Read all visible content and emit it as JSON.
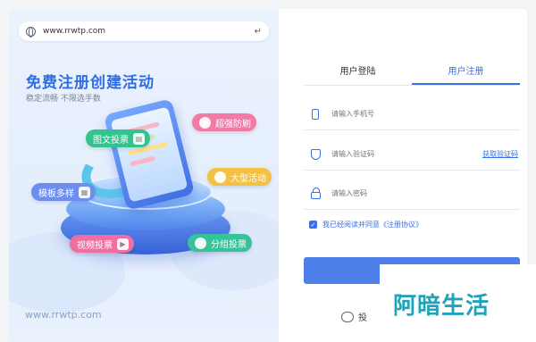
{
  "browser": {
    "url": "www.rrwtp.com",
    "enter_icon": "↵"
  },
  "promo": {
    "title": "免费注册创建活动",
    "subtitle": "稳定流畅 不限选手数",
    "features": {
      "tuwen": "图文投票",
      "chaoqiang": "超强防刷",
      "moban": "模板多样",
      "daxing": "大型活动",
      "shipin": "视频投票",
      "fenzu": "分组投票"
    },
    "footer_url": "www.rrwtp.com"
  },
  "auth": {
    "tabs": [
      "用户登陆",
      "用户注册"
    ],
    "active_tab": "用户注册",
    "phone_placeholder": "请输入手机号",
    "code_placeholder": "请输入验证码",
    "get_code": "获取验证码",
    "password_placeholder": "请输入密码",
    "agree_text": "我已经阅读并同意《注册协议》",
    "agree_checked": true
  },
  "watermark": {
    "logo_text": "阿暗生活",
    "small_text": "投"
  },
  "colors": {
    "accent": "#3d6fe6",
    "title": "#2f6de5",
    "watermark": "#1fa3b8"
  }
}
